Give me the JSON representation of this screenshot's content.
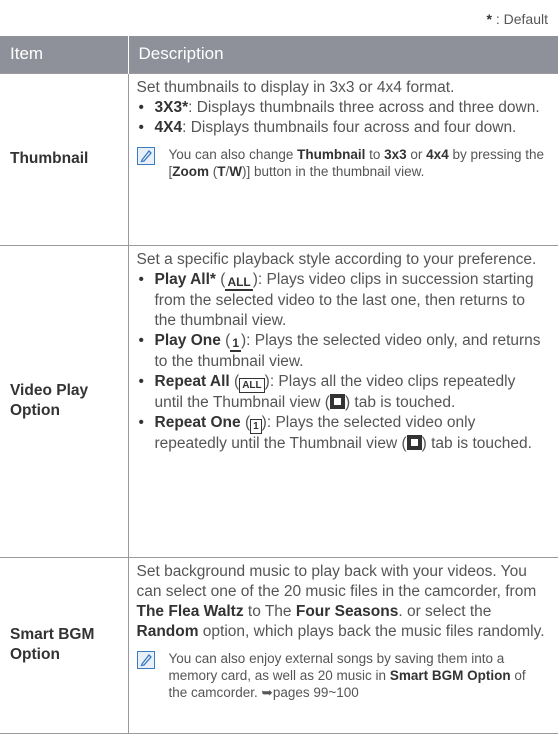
{
  "header_note": {
    "star": "*",
    "text": ": Default"
  },
  "table": {
    "head": {
      "item": "Item",
      "description": "Description"
    },
    "thumbnail": {
      "item": "Thumbnail",
      "intro": "Set thumbnails to display in 3x3 or 4x4 format.",
      "b1_bold": "3X3*",
      "b1_rest": ": Displays thumbnails three across and three down.",
      "b2_bold": "4X4",
      "b2_rest": ": Displays thumbnails four across and four down.",
      "note": {
        "t1": "You can also change ",
        "b1": "Thumbnail",
        "t2": " to ",
        "b2": "3x3",
        "t3": " or ",
        "b3": "4x4",
        "t4": " by pressing the [",
        "b4": "Zoom",
        "t5": " (",
        "b5": "T",
        "t6": "/",
        "b6": "W",
        "t7": ")] button in the thumbnail view."
      }
    },
    "video_play": {
      "item": "Video Play Option",
      "intro": "Set a specific playback style according to your preference.",
      "b1_bold": "Play All*",
      "b1_pre": " (",
      "b1_glyph": "ALL",
      "b1_rest": "): Plays video clips in succession starting from the selected video to the last one, then returns to the thumbnail view.",
      "b2_bold": "Play One",
      "b2_pre": " (",
      "b2_glyph": "1",
      "b2_rest": "): Plays the selected video only, and returns to the thumbnail view.",
      "b3_bold": "Repeat All",
      "b3_pre": " (",
      "b3_glyph": "ALL",
      "b3_mid": "): Plays all the video clips repeatedly until the Thumbnail view (",
      "b3_rest": ") tab is touched.",
      "b4_bold": "Repeat One",
      "b4_pre": " (",
      "b4_glyph": "1",
      "b4_mid": "): Plays the selected video only repeatedly until the Thumbnail view (",
      "b4_rest": ") tab is touched."
    },
    "smart_bgm": {
      "item": "Smart BGM Option",
      "p1": "Set background music to play back with your videos. You can select one of the 20 music files in the camcorder, from ",
      "p_b1": "The Flea Waltz",
      "p2": " to The ",
      "p_b2": "Four Seasons",
      "p3": ". or select the ",
      "p_b3": "Random",
      "p4": " option, which plays back the music files randomly.",
      "note": {
        "t1": "You can also enjoy external songs by saving them into a memory card, as well as 20 music in ",
        "b1": "Smart BGM Option",
        "t2": " of the camcorder. ➥pages 99~100"
      }
    }
  }
}
